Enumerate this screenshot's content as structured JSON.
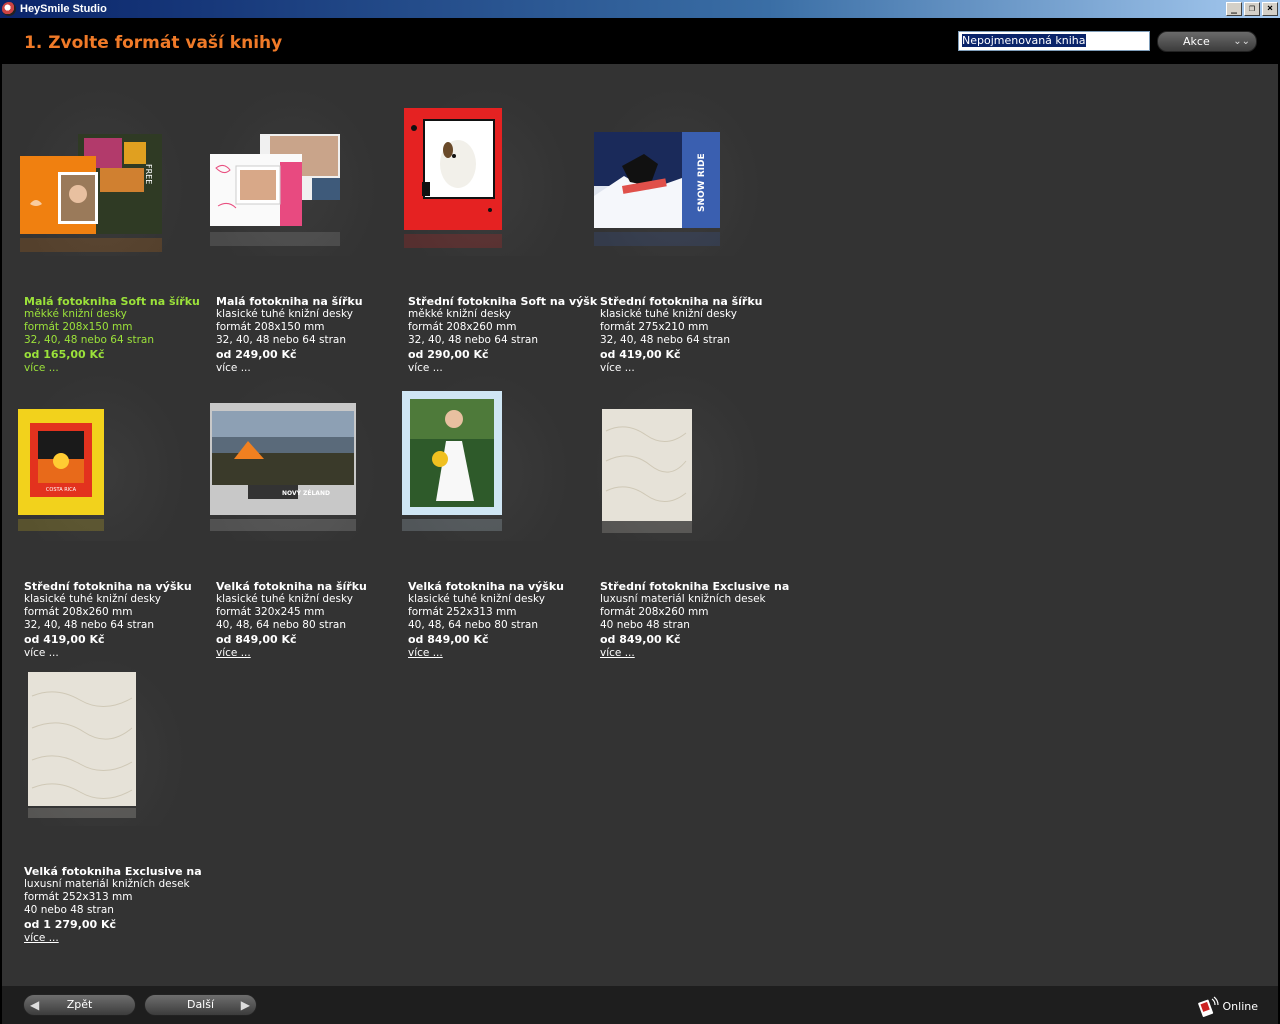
{
  "window": {
    "title": "HeySmile Studio"
  },
  "header": {
    "title": "1. Zvolte formát vaší knihy",
    "book_name_value": "Nepojmenovaná kniha",
    "actions_label": "Akce"
  },
  "products": [
    {
      "name": "Malá fotokniha Soft na šířku",
      "cover": "měkké knižní desky",
      "format": "formát 208x150 mm",
      "pages": "32, 40, 48 nebo 64 stran",
      "price": "od 165,00 Kč",
      "more": "více ..."
    },
    {
      "name": "Malá fotokniha na šířku",
      "cover": "klasické tuhé knižní desky",
      "format": "formát 208x150 mm",
      "pages": "32, 40, 48 nebo 64 stran",
      "price": "od 249,00 Kč",
      "more": "více ..."
    },
    {
      "name": "Střední fotokniha Soft na výšku",
      "cover": "měkké knižní desky",
      "format": "formát 208x260 mm",
      "pages": "32, 40, 48 nebo 64 stran",
      "price": "od 290,00 Kč",
      "more": "více ..."
    },
    {
      "name": "Střední fotokniha na šířku",
      "cover": "klasické tuhé knižní desky",
      "format": "formát 275x210 mm",
      "pages": "32, 40, 48 nebo 64 stran",
      "price": "od 419,00 Kč",
      "more": "více ..."
    },
    {
      "name": "Střední fotokniha na výšku",
      "cover": "klasické tuhé knižní desky",
      "format": "formát 208x260 mm",
      "pages": "32, 40, 48 nebo 64 stran",
      "price": "od 419,00 Kč",
      "more": "více ..."
    },
    {
      "name": "Velká fotokniha na šířku",
      "cover": "klasické tuhé knižní desky",
      "format": "formát 320x245 mm",
      "pages": "40, 48, 64 nebo 80 stran",
      "price": "od 849,00 Kč",
      "more": "více ..."
    },
    {
      "name": "Velká fotokniha na výšku",
      "cover": "klasické tuhé knižní desky",
      "format": "formát 252x313 mm",
      "pages": "40, 48, 64 nebo 80 stran",
      "price": "od 849,00 Kč",
      "more": "více ..."
    },
    {
      "name": "Střední fotokniha Exclusive na",
      "cover": "luxusní materiál knižních desek",
      "format": "formát 208x260 mm",
      "pages": "40 nebo 48 stran",
      "price": "od 849,00 Kč",
      "more": "více ..."
    },
    {
      "name": "Velká fotokniha Exclusive na",
      "cover": "luxusní materiál knižních desek",
      "format": "formát 252x313 mm",
      "pages": "40 nebo 48 stran",
      "price": "od 1 279,00 Kč",
      "more": "více ..."
    }
  ],
  "cover_texts": {
    "snow_ride": "SNOW RIDE",
    "costa_rica": "COSTA RICA",
    "novy_zeland": "NOVÝ ZÉLAND",
    "free": "FREE"
  },
  "footer": {
    "back_label": "Zpět",
    "next_label": "Další",
    "online_label": "Online"
  },
  "colors": {
    "title_orange": "#f07a28",
    "selected_green": "#9be23a",
    "background": "#333333"
  }
}
